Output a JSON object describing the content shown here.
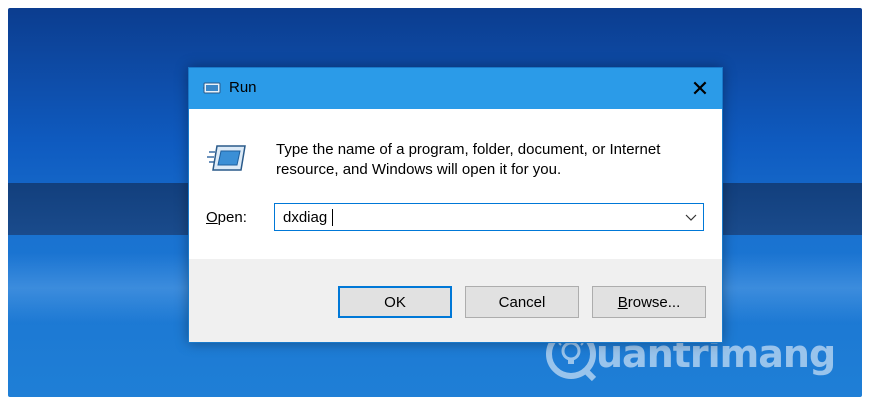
{
  "window": {
    "title": "Run",
    "close_glyph": "✕",
    "title_icon": "run-icon"
  },
  "content": {
    "description": "Type the name of a program, folder, document, or Internet resource, and Windows will open it for you.",
    "open_label_accel": "O",
    "open_label_rest": "pen:",
    "combo_value": "dxdiag",
    "combo_arrow_icon": "chevron-down-icon"
  },
  "buttons": {
    "ok": "OK",
    "cancel": "Cancel",
    "browse_accel": "B",
    "browse_rest": "rowse..."
  },
  "watermark": {
    "text": "uantrimang",
    "logo_icon": "lightbulb-q-logo"
  },
  "colors": {
    "titlebar": "#2b9be8",
    "dialog_border": "#1979ca",
    "focus_blue": "#0078d7",
    "footer_bg": "#f0f0f0",
    "button_bg": "#e1e1e1"
  }
}
